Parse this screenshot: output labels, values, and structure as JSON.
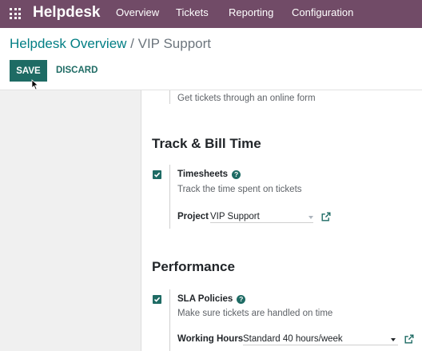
{
  "navbar": {
    "app_name": "Helpdesk",
    "menu": [
      "Overview",
      "Tickets",
      "Reporting",
      "Configuration"
    ]
  },
  "breadcrumb": {
    "parent": "Helpdesk Overview",
    "separator": " / ",
    "current": "VIP Support"
  },
  "buttons": {
    "save": "SAVE",
    "discard": "DISCARD"
  },
  "website_form": {
    "description": "Get tickets through an online form"
  },
  "track_bill_time": {
    "title": "Track & Bill Time",
    "timesheets": {
      "label": "Timesheets",
      "checked": true,
      "description": "Track the time spent on tickets",
      "project_label": "Project",
      "project_value": "VIP Support"
    }
  },
  "performance": {
    "title": "Performance",
    "sla_policies": {
      "label": "SLA Policies",
      "checked": true,
      "description": "Make sure tickets are handled on time",
      "working_hours_label": "Working Hours",
      "working_hours_value": "Standard 40 hours/week"
    }
  },
  "help_glyph": "?",
  "colors": {
    "navbar": "#714B67",
    "primary": "#1e6b64",
    "link": "#017e84"
  }
}
